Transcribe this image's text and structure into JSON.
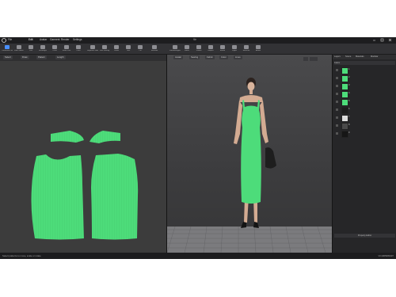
{
  "menubar": {
    "items": [
      "File",
      "Edit",
      "Avatar",
      "Garment",
      "Render",
      "Settings"
    ],
    "window_title": "file"
  },
  "toolbar": {
    "tools": [
      {
        "label": "Transform Pattern",
        "icon": "select-arrow-icon",
        "active": true
      },
      {
        "label": "Edit Pattern",
        "icon": "edit-pattern-icon"
      },
      {
        "label": "Pen",
        "icon": "pen-icon"
      },
      {
        "label": "Rectangle",
        "icon": "rectangle-icon"
      },
      {
        "label": "Circle",
        "icon": "circle-icon"
      },
      {
        "label": "Seam Line",
        "icon": "seam-line-icon"
      },
      {
        "label": "Trace",
        "icon": "trace-icon"
      },
      {
        "label": "Segment Sewing",
        "icon": "segment-sewing-icon"
      },
      {
        "label": "Free Sewing",
        "icon": "free-sewing-icon"
      },
      {
        "label": "Pleats",
        "icon": "pleats-icon"
      },
      {
        "label": "Tack",
        "icon": "tack-icon"
      },
      {
        "label": "Pin",
        "icon": "pin-icon"
      },
      {
        "label": "Simulate",
        "icon": "simulate-icon"
      },
      {
        "label": "Fold Arrangement",
        "icon": "fold-icon"
      },
      {
        "label": "Fabric",
        "icon": "fabric-icon"
      },
      {
        "label": "Texture",
        "icon": "texture-icon"
      },
      {
        "label": "Graphic",
        "icon": "graphic-icon"
      },
      {
        "label": "Button",
        "icon": "button-icon"
      },
      {
        "label": "Zipper",
        "icon": "zipper-icon"
      },
      {
        "label": "Measure",
        "icon": "measure-icon"
      },
      {
        "label": "Avatar",
        "icon": "avatar-icon"
      }
    ]
  },
  "pattern_toolbar": [
    "Select",
    "Draw",
    "Pattern",
    "Length"
  ],
  "avatar_toolbar": [
    "Avatar",
    "Sewing",
    "Fabric",
    "Color",
    "Lines"
  ],
  "object_browser": {
    "tabs": [
      "Layers",
      "Scene",
      "Materials",
      "Modular"
    ],
    "section": "Fabric",
    "fabrics": [
      {
        "name": "1",
        "color": "#4ddc7a"
      },
      {
        "name": "2",
        "color": "#4ddc7a"
      },
      {
        "name": "3",
        "color": "#4ddc7a"
      },
      {
        "name": "4",
        "color": "#4ddc7a"
      },
      {
        "name": "5",
        "color": "#4ddc7a"
      },
      {
        "name": "6",
        "color": "#1c1c1c"
      },
      {
        "name": "7",
        "color": "#dcdcdc"
      },
      {
        "name": "8",
        "color": "#4a4a4a"
      },
      {
        "name": "9",
        "color": "#161616"
      }
    ],
    "property_label": "Property Editor"
  },
  "status": {
    "left": "Select patterns to move, scale or rotate",
    "right": "VC1005080437"
  },
  "colors": {
    "fabric_green": "#4ddc7a",
    "accent_blue": "#4a90ff",
    "panel_dark": "#2b2b2d"
  }
}
